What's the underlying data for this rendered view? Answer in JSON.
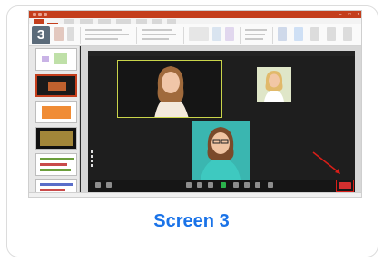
{
  "caption": "Screen 3",
  "screen_number": "3",
  "colors": {
    "accent": "#1a73e8",
    "powerpoint_red": "#c43e1c",
    "end_button": "#d32f2f",
    "highlight_box": "#d91e18"
  },
  "icons": [
    "arrow-annotation-icon",
    "mute-icon",
    "video-icon",
    "share-screen-icon",
    "end-meeting-icon"
  ]
}
